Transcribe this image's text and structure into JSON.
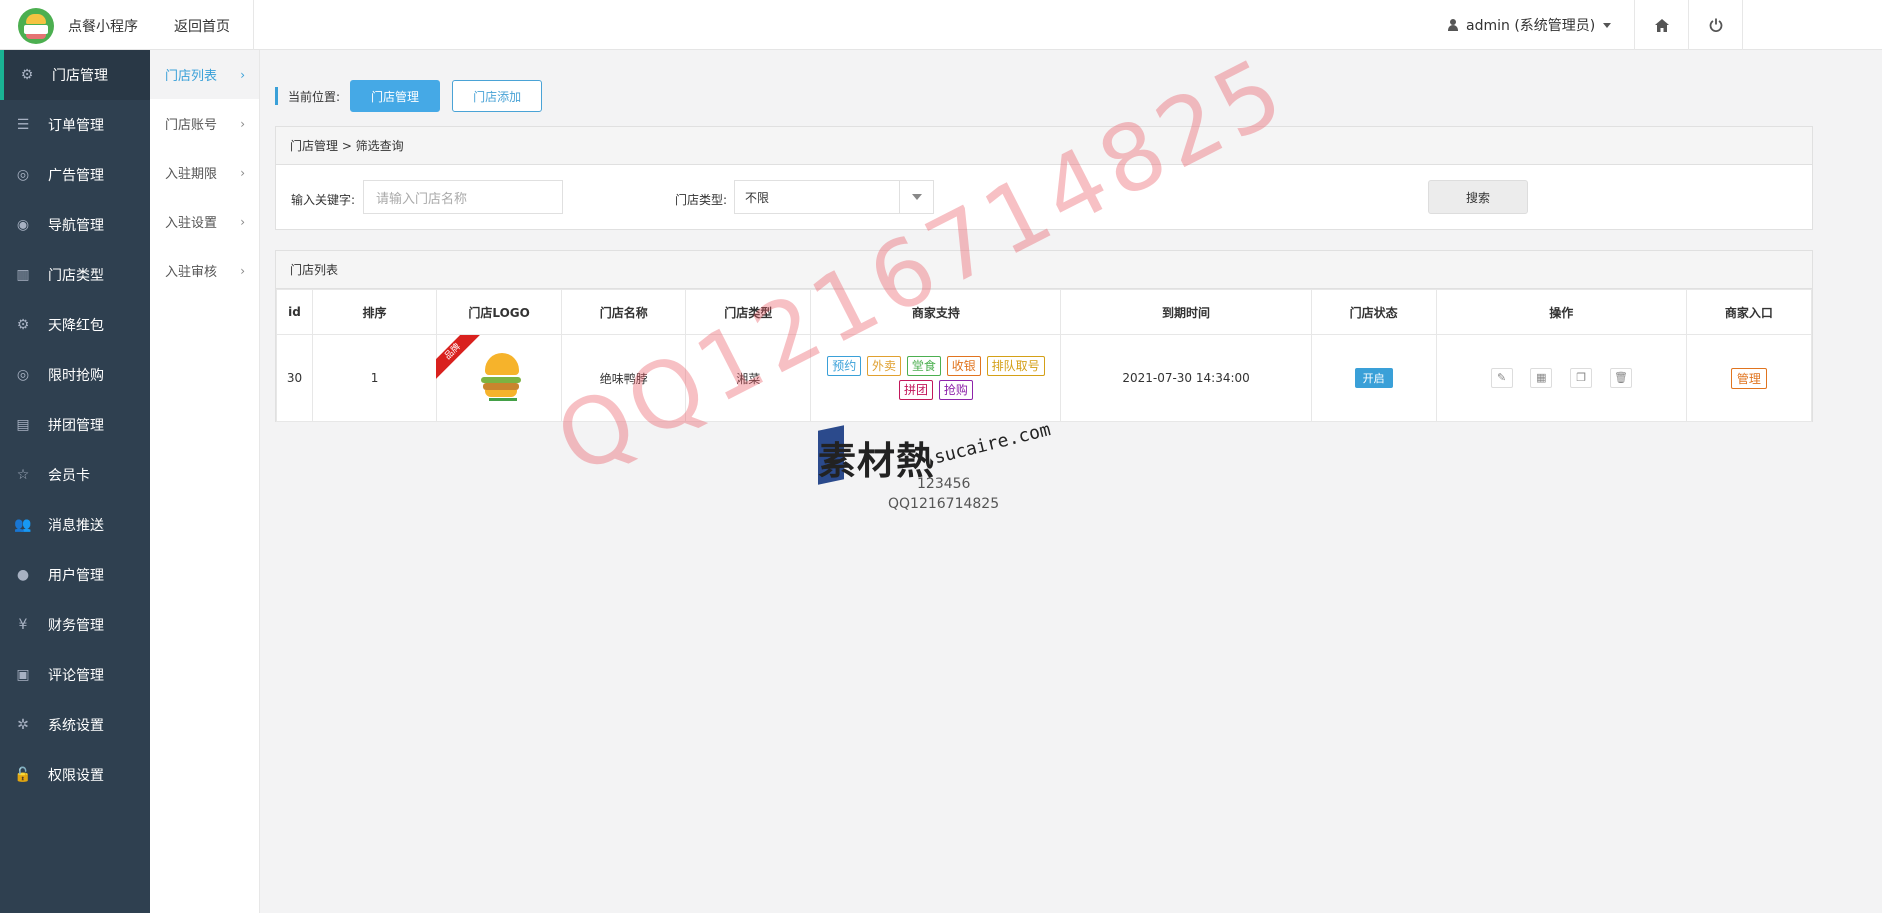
{
  "topbar": {
    "app_title": "点餐小程序",
    "back_home": "返回首页",
    "user_label": "admin (系统管理员)",
    "home_icon": "home-icon",
    "power_icon": "power-icon"
  },
  "sidebar": {
    "items": [
      {
        "label": "门店管理",
        "icon": "cubes-icon",
        "glyph": "⚙"
      },
      {
        "label": "订单管理",
        "icon": "list-icon",
        "glyph": "☰"
      },
      {
        "label": "广告管理",
        "icon": "lifebuoy-icon",
        "glyph": "◎"
      },
      {
        "label": "导航管理",
        "icon": "compass-icon",
        "glyph": "◉"
      },
      {
        "label": "门店类型",
        "icon": "bank-icon",
        "glyph": "▥"
      },
      {
        "label": "天降红包",
        "icon": "cubes-icon",
        "glyph": "⚙"
      },
      {
        "label": "限时抢购",
        "icon": "lifebuoy-icon",
        "glyph": "◎"
      },
      {
        "label": "拼团管理",
        "icon": "newspaper-icon",
        "glyph": "▤"
      },
      {
        "label": "会员卡",
        "icon": "star-half-icon",
        "glyph": "☆"
      },
      {
        "label": "消息推送",
        "icon": "users-icon",
        "glyph": "👥"
      },
      {
        "label": "用户管理",
        "icon": "user-icon",
        "glyph": "●"
      },
      {
        "label": "财务管理",
        "icon": "yen-icon",
        "glyph": "¥"
      },
      {
        "label": "评论管理",
        "icon": "money-icon",
        "glyph": "▣"
      },
      {
        "label": "系统设置",
        "icon": "gear-icon",
        "glyph": "✲"
      },
      {
        "label": "权限设置",
        "icon": "unlock-icon",
        "glyph": "🔓"
      }
    ]
  },
  "subnav": {
    "items": [
      {
        "label": "门店列表"
      },
      {
        "label": "门店账号"
      },
      {
        "label": "入驻期限"
      },
      {
        "label": "入驻设置"
      },
      {
        "label": "入驻审核"
      }
    ]
  },
  "location": {
    "label": "当前位置:",
    "primary_btn": "门店管理",
    "outline_btn": "门店添加"
  },
  "filter": {
    "breadcrumb": "门店管理 > 筛选查询",
    "keyword_label": "输入关键字:",
    "keyword_placeholder": "请输入门店名称",
    "type_label": "门店类型:",
    "type_value": "不限",
    "search_btn": "搜索"
  },
  "list": {
    "title": "门店列表",
    "columns": [
      "id",
      "排序",
      "门店LOGO",
      "门店名称",
      "门店类型",
      "商家支持",
      "到期时间",
      "门店状态",
      "操作",
      "商家入口"
    ],
    "rows": [
      {
        "id": "30",
        "sort": "1",
        "ribbon": "品牌",
        "name": "绝味鸭脖",
        "type": "湘菜",
        "tags": [
          {
            "label": "预约",
            "color": "#3aa0d8"
          },
          {
            "label": "外卖",
            "color": "#e0a030"
          },
          {
            "label": "堂食",
            "color": "#4caf50"
          },
          {
            "label": "收银",
            "color": "#e0741f"
          },
          {
            "label": "排队取号",
            "color": "#d4a017"
          },
          {
            "label": "拼团",
            "color": "#c2185b"
          },
          {
            "label": "抢购",
            "color": "#8e24aa"
          }
        ],
        "expire": "2021-07-30 14:34:00",
        "status": "开启",
        "manage": "管理"
      }
    ]
  },
  "watermarks": {
    "big": "QQ1216714825",
    "logo_text": "素材熱",
    "logo_url": "sucaire.com",
    "small1": "123456",
    "small2": "QQ1216714825"
  }
}
